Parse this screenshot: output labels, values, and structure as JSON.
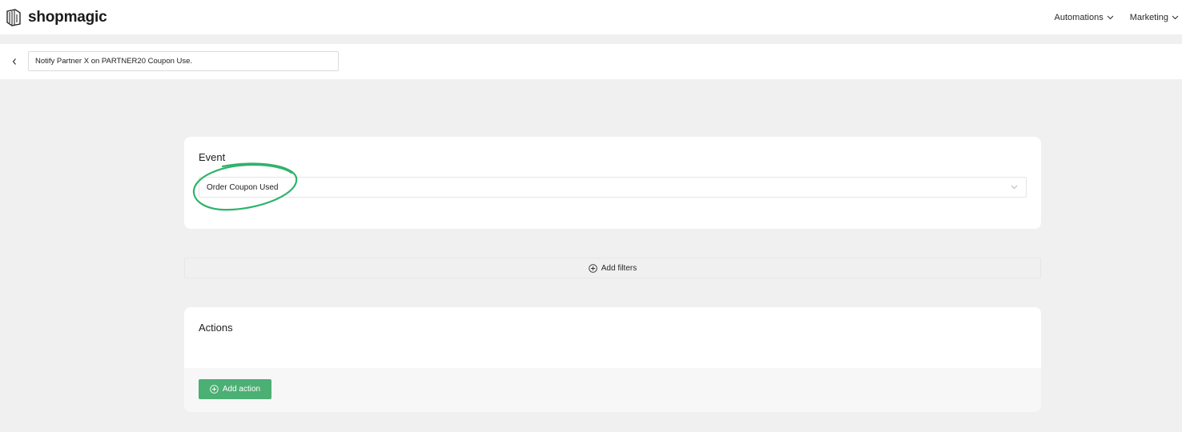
{
  "brand": {
    "name": "shopmagic",
    "logo_icon": "shopmagic-logo-icon"
  },
  "topnav": {
    "items": [
      {
        "label": "Automations",
        "icon": "chevron-down-icon"
      },
      {
        "label": "Marketing",
        "icon": "chevron-down-icon"
      }
    ]
  },
  "titlebar": {
    "back_icon": "chevron-left-icon",
    "automation_name": "Notify Partner X on PARTNER20 Coupon Use."
  },
  "event": {
    "title": "Event",
    "selected_value": "Order Coupon Used",
    "chevron_icon": "chevron-down-icon",
    "highlight_color": "#2eb36a"
  },
  "filters": {
    "label": "Add filters",
    "icon": "plus-circle-icon"
  },
  "actions": {
    "title": "Actions",
    "add_button_label": "Add action",
    "add_button_icon": "plus-circle-icon",
    "button_color": "#4caf74"
  },
  "colors": {
    "page_background": "#f0f0f0",
    "card_background": "#ffffff",
    "accent_green": "#4caf74"
  }
}
